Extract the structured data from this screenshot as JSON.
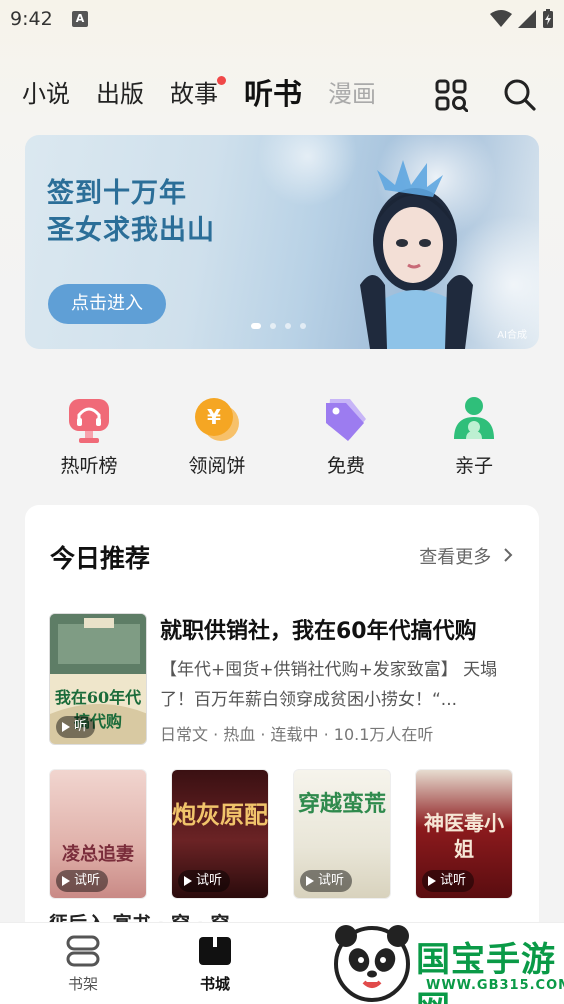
{
  "status_bar": {
    "time": "9:42",
    "a_badge": "A"
  },
  "top_tabs": [
    {
      "label": "小说",
      "active": false
    },
    {
      "label": "出版",
      "active": false
    },
    {
      "label": "故事",
      "active": false,
      "dot": true
    },
    {
      "label": "听书",
      "active": true
    },
    {
      "label": "漫画",
      "active": false
    }
  ],
  "header_icons": {
    "grid": "grid-icon",
    "search": "search-icon"
  },
  "banner": {
    "title_line1": "签到十万年",
    "title_line2": "圣女求我出山",
    "button_label": "点击进入",
    "ai_label": "AI合成",
    "dots": 4,
    "active_dot": 0
  },
  "quick_links": [
    {
      "label": "热听榜",
      "icon": "headphone-trophy-icon",
      "color": "#f06a78"
    },
    {
      "label": "领阅饼",
      "icon": "coin-icon",
      "color": "#f5a623"
    },
    {
      "label": "免费",
      "icon": "tag-icon",
      "color": "#9c7cf0"
    },
    {
      "label": "亲子",
      "icon": "family-icon",
      "color": "#2fbf7a"
    }
  ],
  "recommend": {
    "title": "今日推荐",
    "more_label": "查看更多",
    "featured": {
      "title": "就职供销社，我在60年代搞代购",
      "description": "【年代+囤货+供销社代购+发家致富】 天塌了！百万年薪白领穿成贫困小捞女！“...",
      "meta": "日常文 · 热血 · 连载中 · 10.1万人在听",
      "cover_text": "我在60年代搞代购",
      "cover_play": "听"
    },
    "covers": [
      {
        "text": "凌总追妻",
        "play_label": "试听",
        "bg": "#e9c9c4",
        "fg": "#7a2d3b"
      },
      {
        "text": "炮灰原配",
        "play_label": "试听",
        "bg": "#5b1d1e",
        "fg": "#f1c46b"
      },
      {
        "text": "穿越蛮荒",
        "play_label": "试听",
        "bg": "#f1efe6",
        "fg": "#2f8a4d"
      },
      {
        "text": "神医毒小姐",
        "play_label": "试听",
        "bg": "#7a1316",
        "fg": "#f6e7d6"
      }
    ],
    "partial_titles": "惩后入  宴书 · 穿  · 穿"
  },
  "bottom_nav": [
    {
      "label": "书架",
      "icon": "bookshelf-icon",
      "active": false
    },
    {
      "label": "书城",
      "icon": "book-icon",
      "active": true
    }
  ],
  "watermark": {
    "text": "国宝手游网",
    "url": "WWW.GB315.COM"
  }
}
